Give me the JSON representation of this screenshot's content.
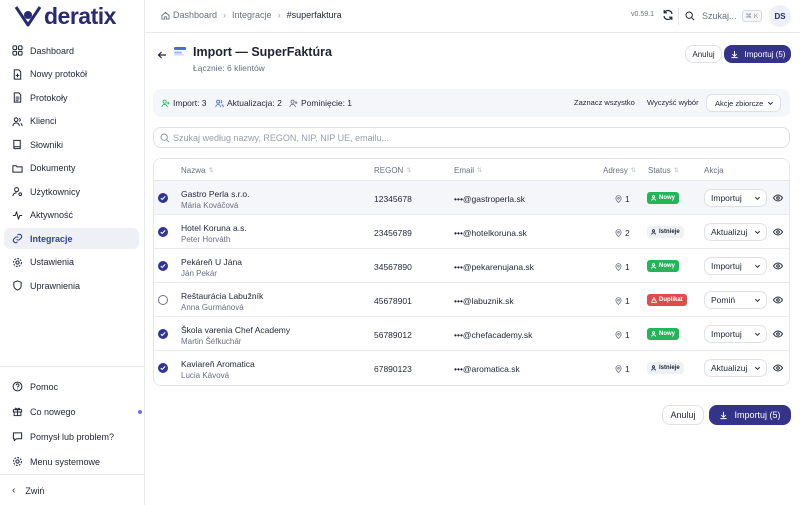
{
  "app": {
    "logo_text": "deratix",
    "version": "v0.59.1",
    "user_initials": "DS"
  },
  "breadcrumb": [
    "Dashboard",
    "Integracje",
    "#superfaktura"
  ],
  "topbar": {
    "search_label": "Szukaj...",
    "search_kbd": "⌘ K"
  },
  "sidebar": {
    "items": [
      {
        "label": "Dashboard",
        "icon": "dashboard-icon"
      },
      {
        "label": "Nowy protokół",
        "icon": "file-plus-icon"
      },
      {
        "label": "Protokoły",
        "icon": "file-text-icon"
      },
      {
        "label": "Klienci",
        "icon": "users-icon"
      },
      {
        "label": "Słowniki",
        "icon": "book-icon"
      },
      {
        "label": "Dokumenty",
        "icon": "folder-icon"
      },
      {
        "label": "Użytkownicy",
        "icon": "user-cog-icon"
      },
      {
        "label": "Aktywność",
        "icon": "activity-icon"
      },
      {
        "label": "Integracje",
        "icon": "link-icon",
        "active": true
      },
      {
        "label": "Ustawienia",
        "icon": "gear-icon"
      },
      {
        "label": "Uprawnienia",
        "icon": "shield-icon"
      }
    ],
    "bottom": [
      {
        "label": "Pomoc",
        "icon": "help-icon"
      },
      {
        "label": "Co nowego",
        "icon": "gift-icon"
      },
      {
        "label": "Pomysł lub problem?",
        "icon": "message-icon"
      },
      {
        "label": "Menu systemowe",
        "icon": "gear-icon"
      }
    ],
    "collapse_label": "Zwiń"
  },
  "header": {
    "title": "Import — SuperFaktúra",
    "subtitle": "Łącznie: 6 klientów",
    "cancel_label": "Anuluj",
    "import_label": "Importuj (5)"
  },
  "summary": {
    "import": "Import: 3",
    "update": "Aktualizacja: 2",
    "skip": "Pominięcie: 1",
    "select_all": "Zaznacz wszystko",
    "clear": "Wyczyść wybór",
    "bulk": "Akcje zbiorcze"
  },
  "search": {
    "placeholder": "Szukaj według nazwy, REGON, NIP, NIP UE, emailu..."
  },
  "table": {
    "columns": [
      "Nazwa",
      "REGON",
      "Email",
      "Adresy",
      "Status",
      "Akcja"
    ],
    "rows": [
      {
        "selected": true,
        "name": "Gastro Perla s.r.o.",
        "contact": "Mária Kováčová",
        "regon": "12345678",
        "email": "•••@gastroperla.sk",
        "addresses": "1",
        "status": "Nowy",
        "status_type": "new",
        "action": "Importuj"
      },
      {
        "selected": true,
        "name": "Hotel Koruna a.s.",
        "contact": "Peter Horváth",
        "regon": "23456789",
        "email": "•••@hotelkoruna.sk",
        "addresses": "2",
        "status": "Istnieje",
        "status_type": "exists",
        "action": "Aktualizuj"
      },
      {
        "selected": true,
        "name": "Pekáreň U Jána",
        "contact": "Ján Pekár",
        "regon": "34567890",
        "email": "•••@pekarenujana.sk",
        "addresses": "1",
        "status": "Nowy",
        "status_type": "new",
        "action": "Importuj"
      },
      {
        "selected": false,
        "name": "Reštaurácia Labužník",
        "contact": "Anna Gurmánová",
        "regon": "45678901",
        "email": "•••@labuznik.sk",
        "addresses": "1",
        "status": "Duplikat",
        "status_type": "dup",
        "action": "Pomiń"
      },
      {
        "selected": true,
        "name": "Škola varenia Chef Academy",
        "contact": "Martin Šéfkuchár",
        "regon": "56789012",
        "email": "•••@chefacademy.sk",
        "addresses": "1",
        "status": "Nowy",
        "status_type": "new",
        "action": "Importuj"
      },
      {
        "selected": true,
        "name": "Kaviareň Aromatica",
        "contact": "Lucia Kávová",
        "regon": "67890123",
        "email": "•••@aromatica.sk",
        "addresses": "1",
        "status": "Istnieje",
        "status_type": "exists",
        "action": "Aktualizuj"
      }
    ]
  },
  "footer": {
    "cancel_label": "Anuluj",
    "import_label": "Importuj (5)"
  },
  "colors": {
    "primary": "#34338a",
    "active_nav": "#2e3fa6",
    "new": "#22b55a",
    "duplicate": "#e24b4b"
  }
}
